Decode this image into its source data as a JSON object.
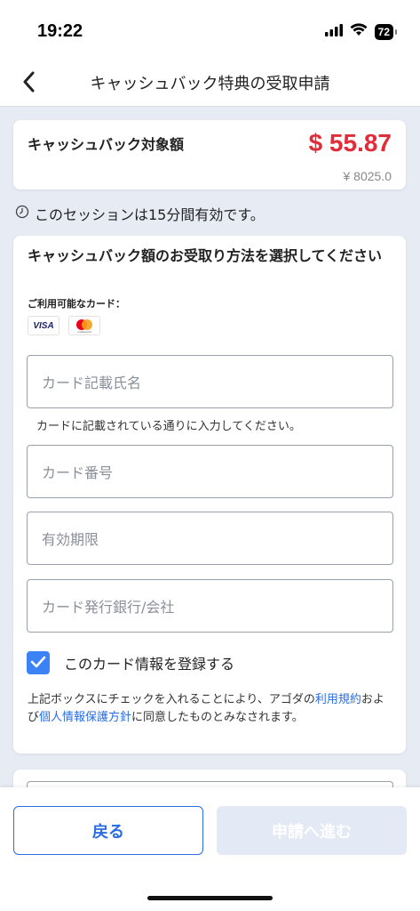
{
  "status": {
    "time": "19:22",
    "battery": "72"
  },
  "nav": {
    "title": "キャッシュバック特典の受取申請",
    "back_icon": "chevron-left-icon"
  },
  "amount": {
    "label": "キャッシュバック対象額",
    "usd": "$ 55.87",
    "jpy": "¥ 8025.0",
    "accent_color": "#e12d39"
  },
  "session": {
    "text": "このセッションは15分間有効です。"
  },
  "form": {
    "title": "キャッシュバック額のお受取り方法を選択してください",
    "cards_label": "ご利用可能なカード：",
    "card_brands": [
      "VISA",
      "mastercard"
    ],
    "fields": {
      "cardholder_placeholder": "カード記載氏名",
      "cardholder_hint": "カードに記載されている通りに入力してください。",
      "card_number_placeholder": "カード番号",
      "expiry_placeholder": "有効期限",
      "issuer_placeholder": "カード発行銀行/会社"
    },
    "save_card": {
      "checked": true,
      "label": "このカード情報を登録する"
    },
    "consent": {
      "part1": "上記ボックスにチェックを入れることにより、アゴダの",
      "terms_link": "利用規約",
      "part2": "および",
      "privacy_link": "個人情報保護方針",
      "part3": "に同意したものとみなされます。"
    }
  },
  "footer": {
    "back_label": "戻る",
    "next_label": "申請へ進む",
    "primary_color": "#2a6de0"
  }
}
